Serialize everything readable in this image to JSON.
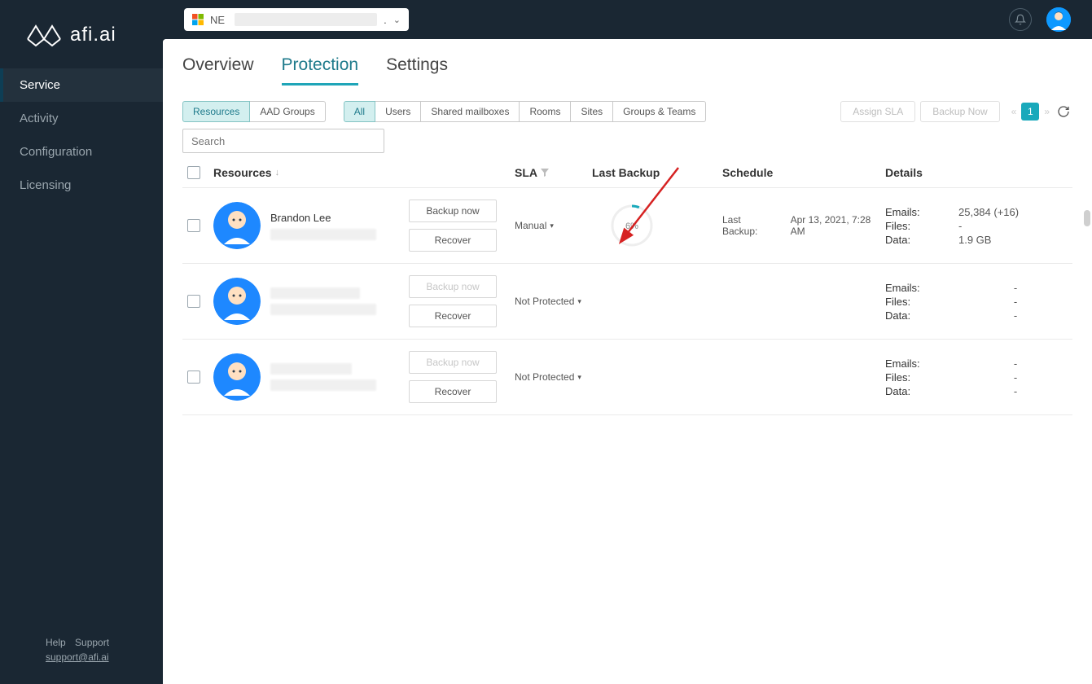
{
  "brand": "afi.ai",
  "nav": {
    "items": [
      {
        "label": "Service",
        "active": true
      },
      {
        "label": "Activity"
      },
      {
        "label": "Configuration"
      },
      {
        "label": "Licensing"
      }
    ]
  },
  "footer": {
    "help": "Help",
    "support": "Support",
    "email": "support@afi.ai"
  },
  "topbar": {
    "tenant_prefix": "NE",
    "tenant_suffix": "."
  },
  "tabs": {
    "overview": "Overview",
    "protection": "Protection",
    "settings": "Settings"
  },
  "subtabs1": {
    "resources": "Resources",
    "aad": "AAD Groups"
  },
  "subtabs2": {
    "all": "All",
    "users": "Users",
    "shared": "Shared mailboxes",
    "rooms": "Rooms",
    "sites": "Sites",
    "groups": "Groups & Teams"
  },
  "search": {
    "placeholder": "Search"
  },
  "actions": {
    "assign_sla": "Assign SLA",
    "backup_now": "Backup Now"
  },
  "pager": {
    "page": "1",
    "prev": "«",
    "next": "»"
  },
  "headers": {
    "resources": "Resources",
    "sla": "SLA",
    "last_backup": "Last Backup",
    "schedule": "Schedule",
    "details": "Details",
    "sort_arrow": "↓"
  },
  "detail_labels": {
    "emails": "Emails:",
    "files": "Files:",
    "data": "Data:"
  },
  "row_actions": {
    "backup": "Backup now",
    "recover": "Recover"
  },
  "rows": [
    {
      "name": "Brandon Lee",
      "backup_enabled": true,
      "sla": "Manual",
      "progress": "6%",
      "schedule_label": "Last Backup:",
      "schedule_value": "Apr 13, 2021, 7:28 AM",
      "emails": "25,384 (+16)",
      "files": "-",
      "data": "1.9 GB"
    },
    {
      "name": "",
      "backup_enabled": false,
      "sla": "Not Protected",
      "emails": "-",
      "files": "-",
      "data": "-"
    },
    {
      "name": "",
      "backup_enabled": false,
      "sla": "Not Protected",
      "emails": "-",
      "files": "-",
      "data": "-"
    }
  ]
}
